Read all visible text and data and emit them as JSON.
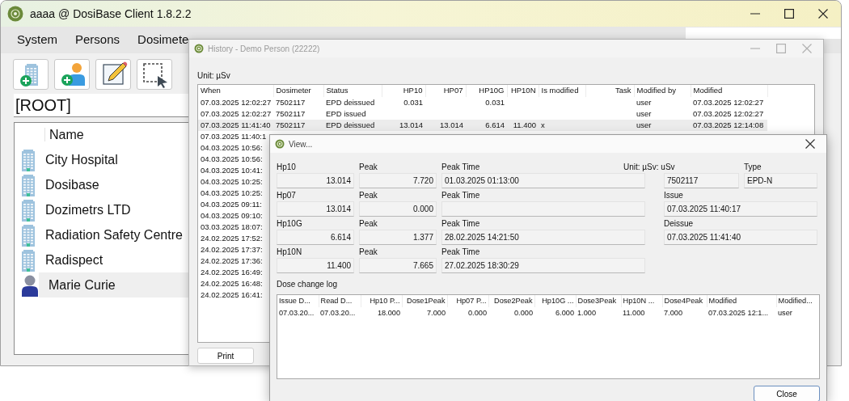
{
  "main_window": {
    "title": "aaaa @ DosiBase Client 1.8.2.2",
    "menu": [
      "System",
      "Persons",
      "Dosimete"
    ],
    "path": "[ROOT]",
    "tree": {
      "header": "Name",
      "items": [
        {
          "label": "City Hospital",
          "kind": "organization",
          "selected": false
        },
        {
          "label": "Dosibase",
          "kind": "organization",
          "selected": false
        },
        {
          "label": "Dozimetrs LTD",
          "kind": "organization",
          "selected": false
        },
        {
          "label": "Radiation Safety Centre",
          "kind": "organization",
          "selected": false
        },
        {
          "label": "Radispect",
          "kind": "organization",
          "selected": false
        },
        {
          "label": "Marie Curie",
          "kind": "person",
          "selected": true
        }
      ]
    }
  },
  "history_window": {
    "title": "History - Demo Person (22222)",
    "unit": "Unit: µSv",
    "columns": [
      "When",
      "Dosimeter",
      "Status",
      "HP10",
      "HP07",
      "HP10G",
      "HP10N",
      "Is modified",
      "Task",
      "Modified by",
      "Modified"
    ],
    "rows": [
      {
        "selected": false,
        "cells": [
          "07.03.2025 12:02:27",
          "7502117",
          "EPD deissued",
          "0.031",
          "",
          "0.031",
          "",
          "",
          "",
          "user",
          "07.03.2025 12:02:27"
        ]
      },
      {
        "selected": false,
        "cells": [
          "07.03.2025 12:02:27",
          "7502117",
          "EPD issued",
          "",
          "",
          "",
          "",
          "",
          "",
          "user",
          "07.03.2025 12:02:27"
        ]
      },
      {
        "selected": true,
        "cells": [
          "07.03.2025 11:41:40",
          "7502117",
          "EPD deissued",
          "13.014",
          "13.014",
          "6.614",
          "11.400",
          "x",
          "",
          "user",
          "07.03.2025 12:14:08"
        ]
      },
      {
        "selected": false,
        "cells": [
          "07.03.2025 11:40:1"
        ]
      },
      {
        "selected": false,
        "cells": [
          "04.03.2025 10:56:"
        ]
      },
      {
        "selected": false,
        "cells": [
          "04.03.2025 10:56:"
        ]
      },
      {
        "selected": false,
        "cells": [
          "04.03.2025 10:41:"
        ]
      },
      {
        "selected": false,
        "cells": [
          "04.03.2025 10:25:"
        ]
      },
      {
        "selected": false,
        "cells": [
          "04.03.2025 10:25:"
        ]
      },
      {
        "selected": false,
        "cells": [
          "04.03.2025 09:11:"
        ]
      },
      {
        "selected": false,
        "cells": [
          "04.03.2025 09:10:"
        ]
      },
      {
        "selected": false,
        "cells": [
          "03.03.2025 18:07:"
        ]
      },
      {
        "selected": false,
        "cells": [
          "24.02.2025 17:52:"
        ]
      },
      {
        "selected": false,
        "cells": [
          "24.02.2025 17:37:"
        ]
      },
      {
        "selected": false,
        "cells": [
          "24.02.2025 17:36:"
        ]
      },
      {
        "selected": false,
        "cells": [
          "24.02.2025 16:49:"
        ]
      },
      {
        "selected": false,
        "cells": [
          "24.02.2025 16:48:"
        ]
      },
      {
        "selected": false,
        "cells": [
          "24.02.2025 16:41:"
        ]
      }
    ],
    "buttons": [
      "Print"
    ]
  },
  "view_dialog": {
    "title": "View...",
    "doses": [
      {
        "label": "Hp10",
        "value": "13.014",
        "peak_label": "Peak",
        "peak": "7.720",
        "peak_time_label": "Peak Time",
        "peak_time": "01.03.2025 01:13:00"
      },
      {
        "label": "Hp07",
        "value": "13.014",
        "peak_label": "Peak",
        "peak": "0.000",
        "peak_time_label": "Peak Time"
      },
      {
        "label": "Hp10G",
        "value": "6.614",
        "peak_label": "Peak",
        "peak": "1.377",
        "peak_time_label": "Peak Time",
        "peak_time": "28.02.2025 14:21:50"
      },
      {
        "label": "Hp10N",
        "value": "11.400",
        "peak_label": "Peak",
        "peak": "7.665",
        "peak_time_label": "Peak Time",
        "peak_time": "27.02.2025 18:30:29"
      }
    ],
    "unit": "Unit: µSv: uSv",
    "dosimeter": "7502117",
    "type_label": "Type",
    "type": "EPD-N",
    "issue_label": "Issue",
    "issue": "07.03.2025 11:40:17",
    "deissue_label": "Deissue",
    "deissue": "07.03.2025 11:41:40",
    "log_title": "Dose change log",
    "log_columns": [
      "Issue D...",
      "Read D...",
      "Hp10 P...",
      "Dose1Peak",
      "Hp07 P...",
      "Dose2Peak",
      "Hp10G ...",
      "Dose3Peak",
      "Hp10N ...",
      "Dose4Peak",
      "Modified",
      "Modified..."
    ],
    "log_rows": [
      [
        "07.03.20...",
        "07.03.20...",
        "18.000",
        "7.000",
        "0.000",
        "0.000",
        "6.000",
        "1.000",
        "11.000",
        "7.000",
        "07.03.2025 12:1...",
        "user"
      ]
    ],
    "close": "Close"
  }
}
